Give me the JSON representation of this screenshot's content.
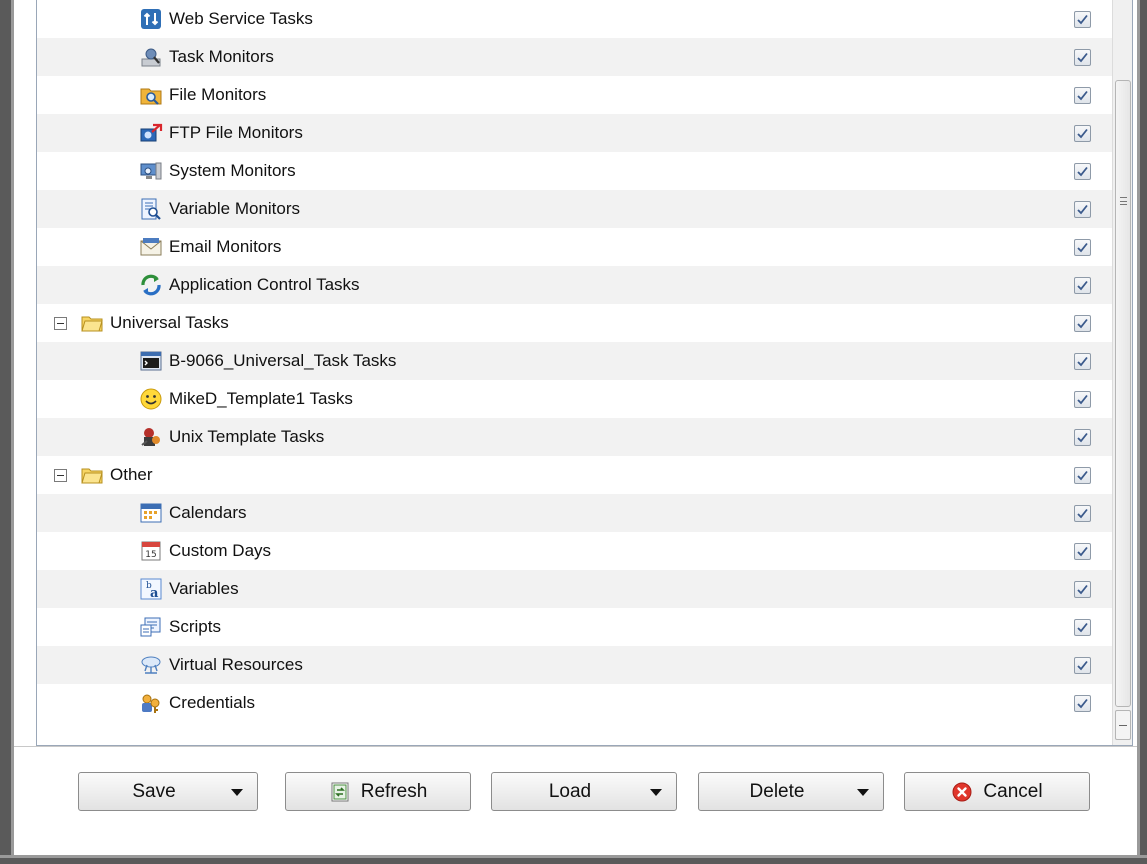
{
  "tree": {
    "rows": [
      {
        "kind": "item",
        "icon": "web-service-icon",
        "label": "Web Service Tasks",
        "checked": true
      },
      {
        "kind": "item",
        "icon": "task-monitor-icon",
        "label": "Task Monitors",
        "checked": true
      },
      {
        "kind": "item",
        "icon": "file-monitor-icon",
        "label": "File Monitors",
        "checked": true
      },
      {
        "kind": "item",
        "icon": "ftp-file-monitor-icon",
        "label": "FTP File Monitors",
        "checked": true
      },
      {
        "kind": "item",
        "icon": "system-monitor-icon",
        "label": "System Monitors",
        "checked": true
      },
      {
        "kind": "item",
        "icon": "variable-monitor-icon",
        "label": "Variable Monitors",
        "checked": true
      },
      {
        "kind": "item",
        "icon": "email-monitor-icon",
        "label": "Email Monitors",
        "checked": true
      },
      {
        "kind": "item",
        "icon": "application-control-icon",
        "label": "Application Control Tasks",
        "checked": true
      },
      {
        "kind": "group",
        "icon": "folder-icon",
        "label": "Universal Tasks",
        "checked": true
      },
      {
        "kind": "item",
        "icon": "terminal-icon",
        "label": "B-9066_Universal_Task Tasks",
        "checked": true
      },
      {
        "kind": "item",
        "icon": "smiley-icon",
        "label": "MikeD_Template1 Tasks",
        "checked": true
      },
      {
        "kind": "item",
        "icon": "unix-template-icon",
        "label": "Unix Template Tasks",
        "checked": true
      },
      {
        "kind": "group",
        "icon": "folder-icon",
        "label": "Other",
        "checked": true
      },
      {
        "kind": "item",
        "icon": "calendar-icon",
        "label": "Calendars",
        "checked": true
      },
      {
        "kind": "item",
        "icon": "custom-day-icon",
        "label": "Custom Days",
        "checked": true
      },
      {
        "kind": "item",
        "icon": "variable-icon",
        "label": "Variables",
        "checked": true
      },
      {
        "kind": "item",
        "icon": "script-icon",
        "label": "Scripts",
        "checked": true
      },
      {
        "kind": "item",
        "icon": "virtual-resource-icon",
        "label": "Virtual Resources",
        "checked": true
      },
      {
        "kind": "item",
        "icon": "credentials-icon",
        "label": "Credentials",
        "checked": true
      }
    ]
  },
  "buttons": {
    "save": {
      "label": "Save"
    },
    "refresh": {
      "label": "Refresh",
      "icon": "refresh-icon"
    },
    "load": {
      "label": "Load"
    },
    "delete": {
      "label": "Delete"
    },
    "cancel": {
      "label": "Cancel",
      "icon": "cancel-icon"
    }
  },
  "colors": {
    "row_alt": "#f2f2f2",
    "folder": "#f2c230",
    "cancel_red": "#e0362c",
    "check_blue": "#3b5a8c"
  }
}
